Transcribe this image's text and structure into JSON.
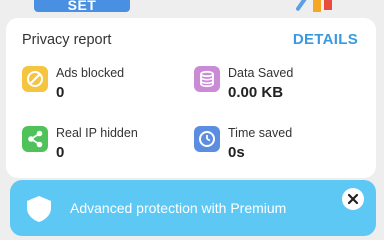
{
  "top": {
    "set_label": "SET"
  },
  "report": {
    "title": "Privacy report",
    "details_label": "DETAILS",
    "stats": [
      {
        "label": "Ads blocked",
        "value": "0",
        "icon": "block-icon",
        "color": "#f5c542"
      },
      {
        "label": "Data Saved",
        "value": "0.00 KB",
        "icon": "database-icon",
        "color": "#c98ad6"
      },
      {
        "label": "Real IP hidden",
        "value": "0",
        "icon": "share-icon",
        "color": "#4fc35a"
      },
      {
        "label": "Time saved",
        "value": "0s",
        "icon": "clock-icon",
        "color": "#5b8de0"
      }
    ]
  },
  "promo": {
    "text": "Advanced protection with Premium",
    "background": "#5ec8f5"
  },
  "colors": {
    "accent": "#3a9ae0",
    "page_background": "#eeeeee"
  }
}
